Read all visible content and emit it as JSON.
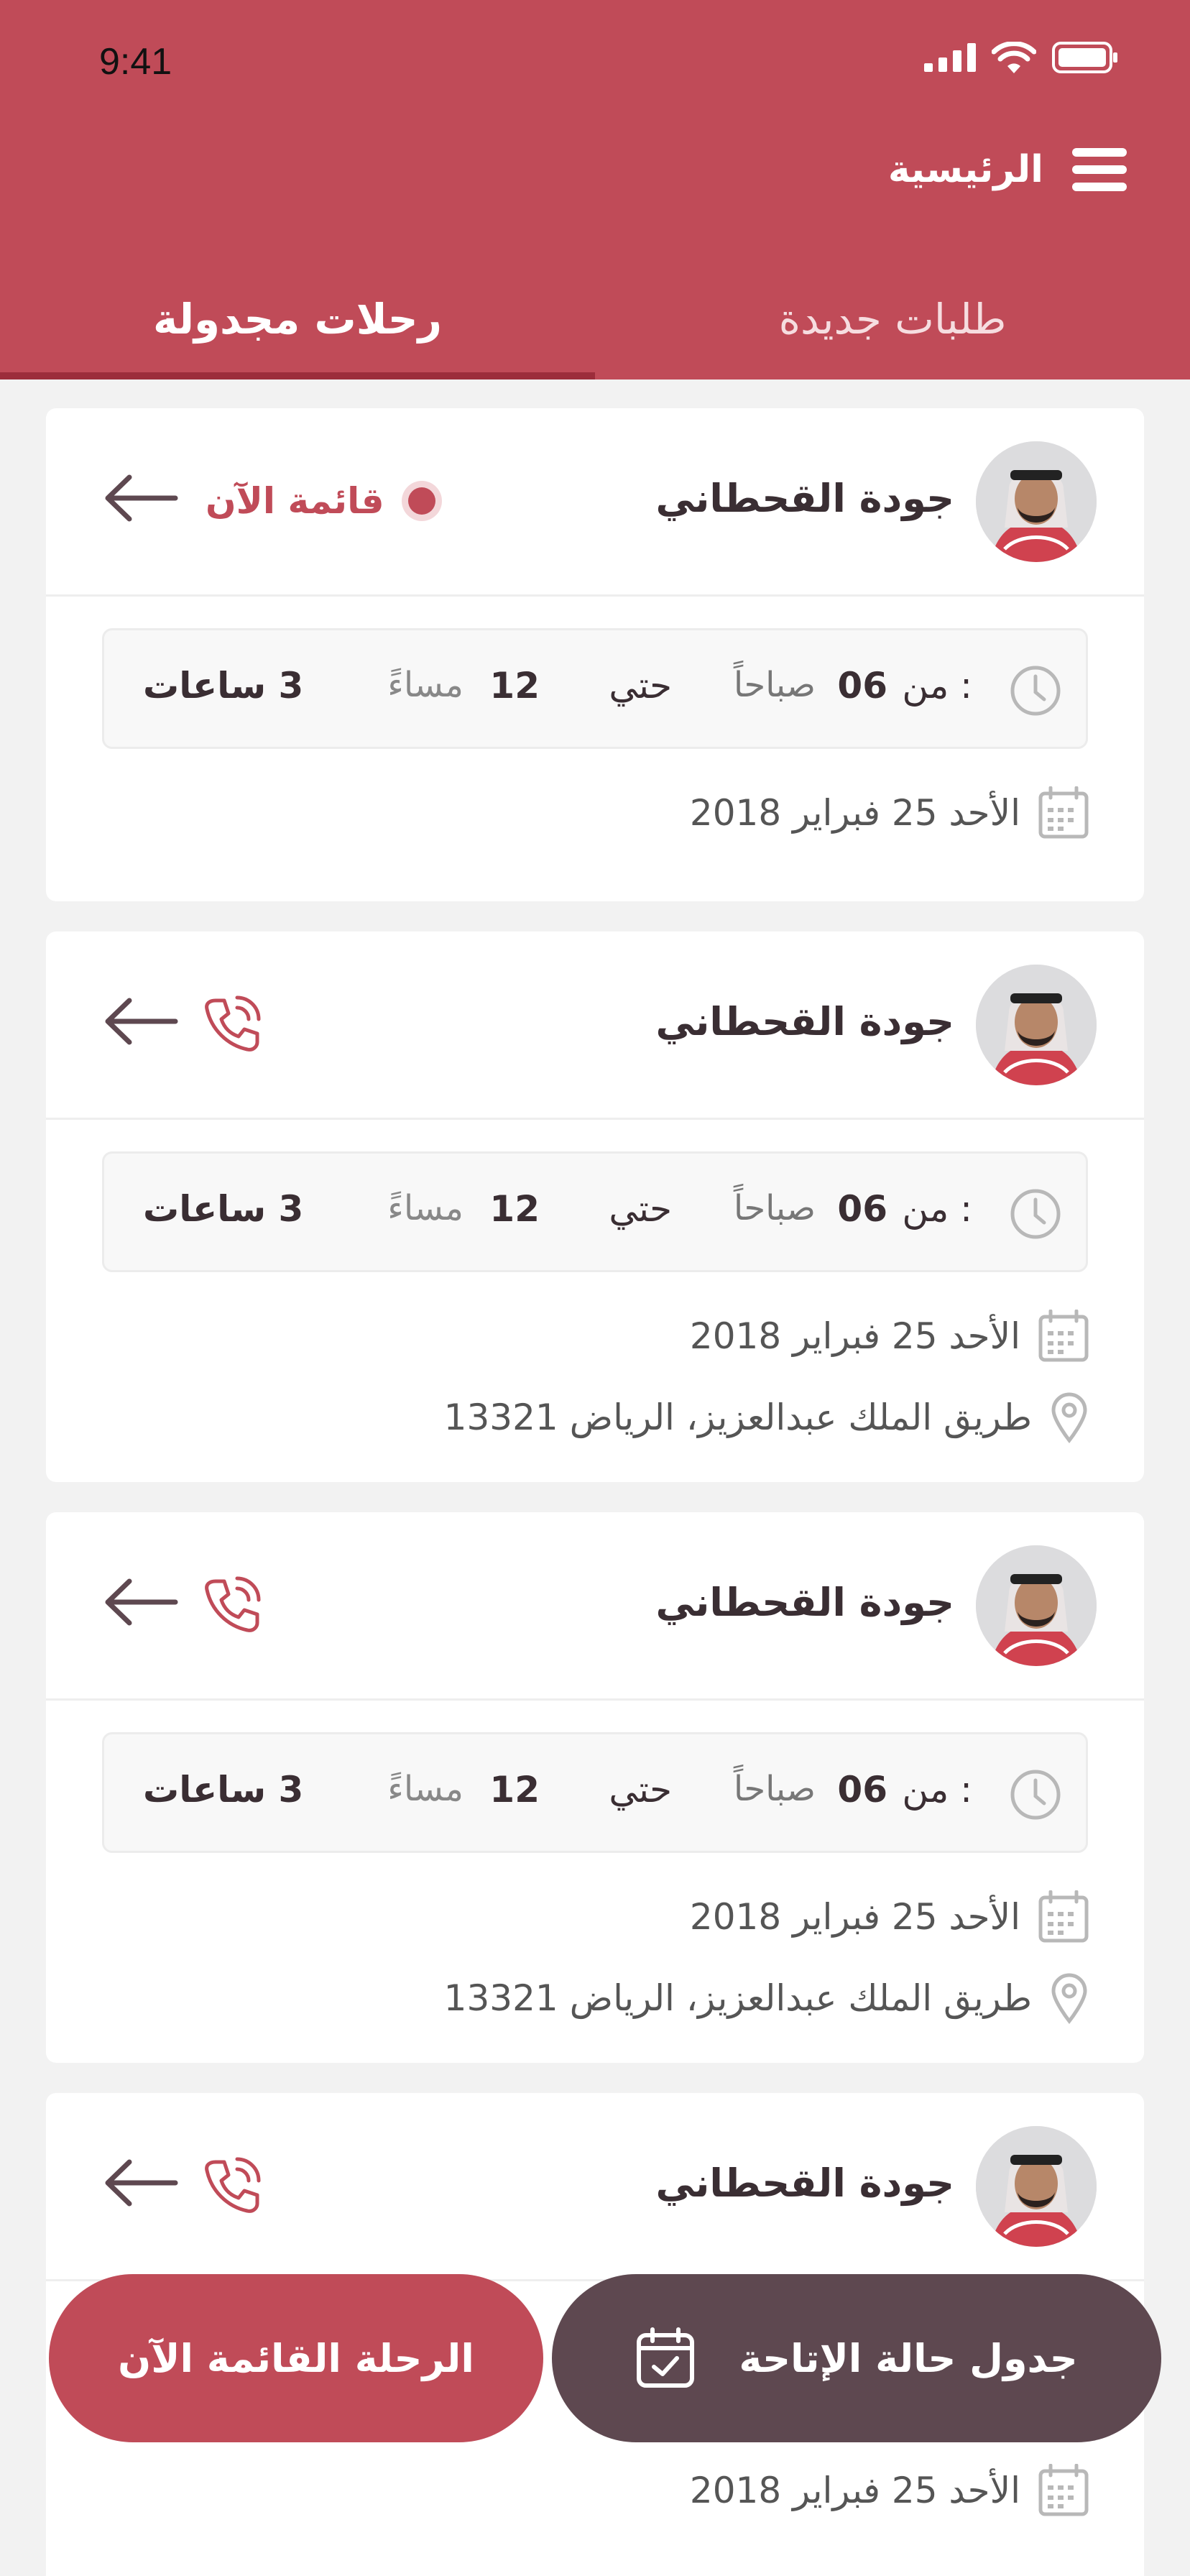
{
  "status_bar": {
    "time": "9:41"
  },
  "header": {
    "title": "الرئيسية",
    "menu_icon": "menu-icon"
  },
  "tabs": [
    {
      "label": "طلبات جديدة",
      "active": false
    },
    {
      "label": "رحلات مجدولة",
      "active": true
    }
  ],
  "colors": {
    "brand": "#c04b58",
    "dark": "#5e4850",
    "background": "#f2f2f2"
  },
  "cards": [
    {
      "driver": "جودة القحطاني",
      "live_label": "قائمة الآن",
      "from_label": "من :",
      "from_time": "06",
      "from_unit": "صباحاً",
      "until": "حتي",
      "to_time": "12",
      "to_unit": "مساءً",
      "duration": "3 ساعات",
      "date": "الأحد 25 فبراير 2018"
    },
    {
      "driver": "جودة القحطاني",
      "from_label": "من :",
      "from_time": "06",
      "from_unit": "صباحاً",
      "until": "حتي",
      "to_time": "12",
      "to_unit": "مساءً",
      "duration": "3 ساعات",
      "date": "الأحد 25 فبراير 2018",
      "address": "طريق الملك عبدالعزيز، الرياض 13321"
    },
    {
      "driver": "جودة القحطاني",
      "from_label": "من :",
      "from_time": "06",
      "from_unit": "صباحاً",
      "until": "حتي",
      "to_time": "12",
      "to_unit": "مساءً",
      "duration": "3 ساعات",
      "date": "الأحد 25 فبراير 2018",
      "address": "طريق الملك عبدالعزيز، الرياض 13321"
    },
    {
      "driver": "جودة القحطاني",
      "date": "الأحد 25 فبراير 2018"
    }
  ],
  "buttons": {
    "live_trip": "الرحلة القائمة الآن",
    "availability": "جدول حالة الإتاحة"
  }
}
